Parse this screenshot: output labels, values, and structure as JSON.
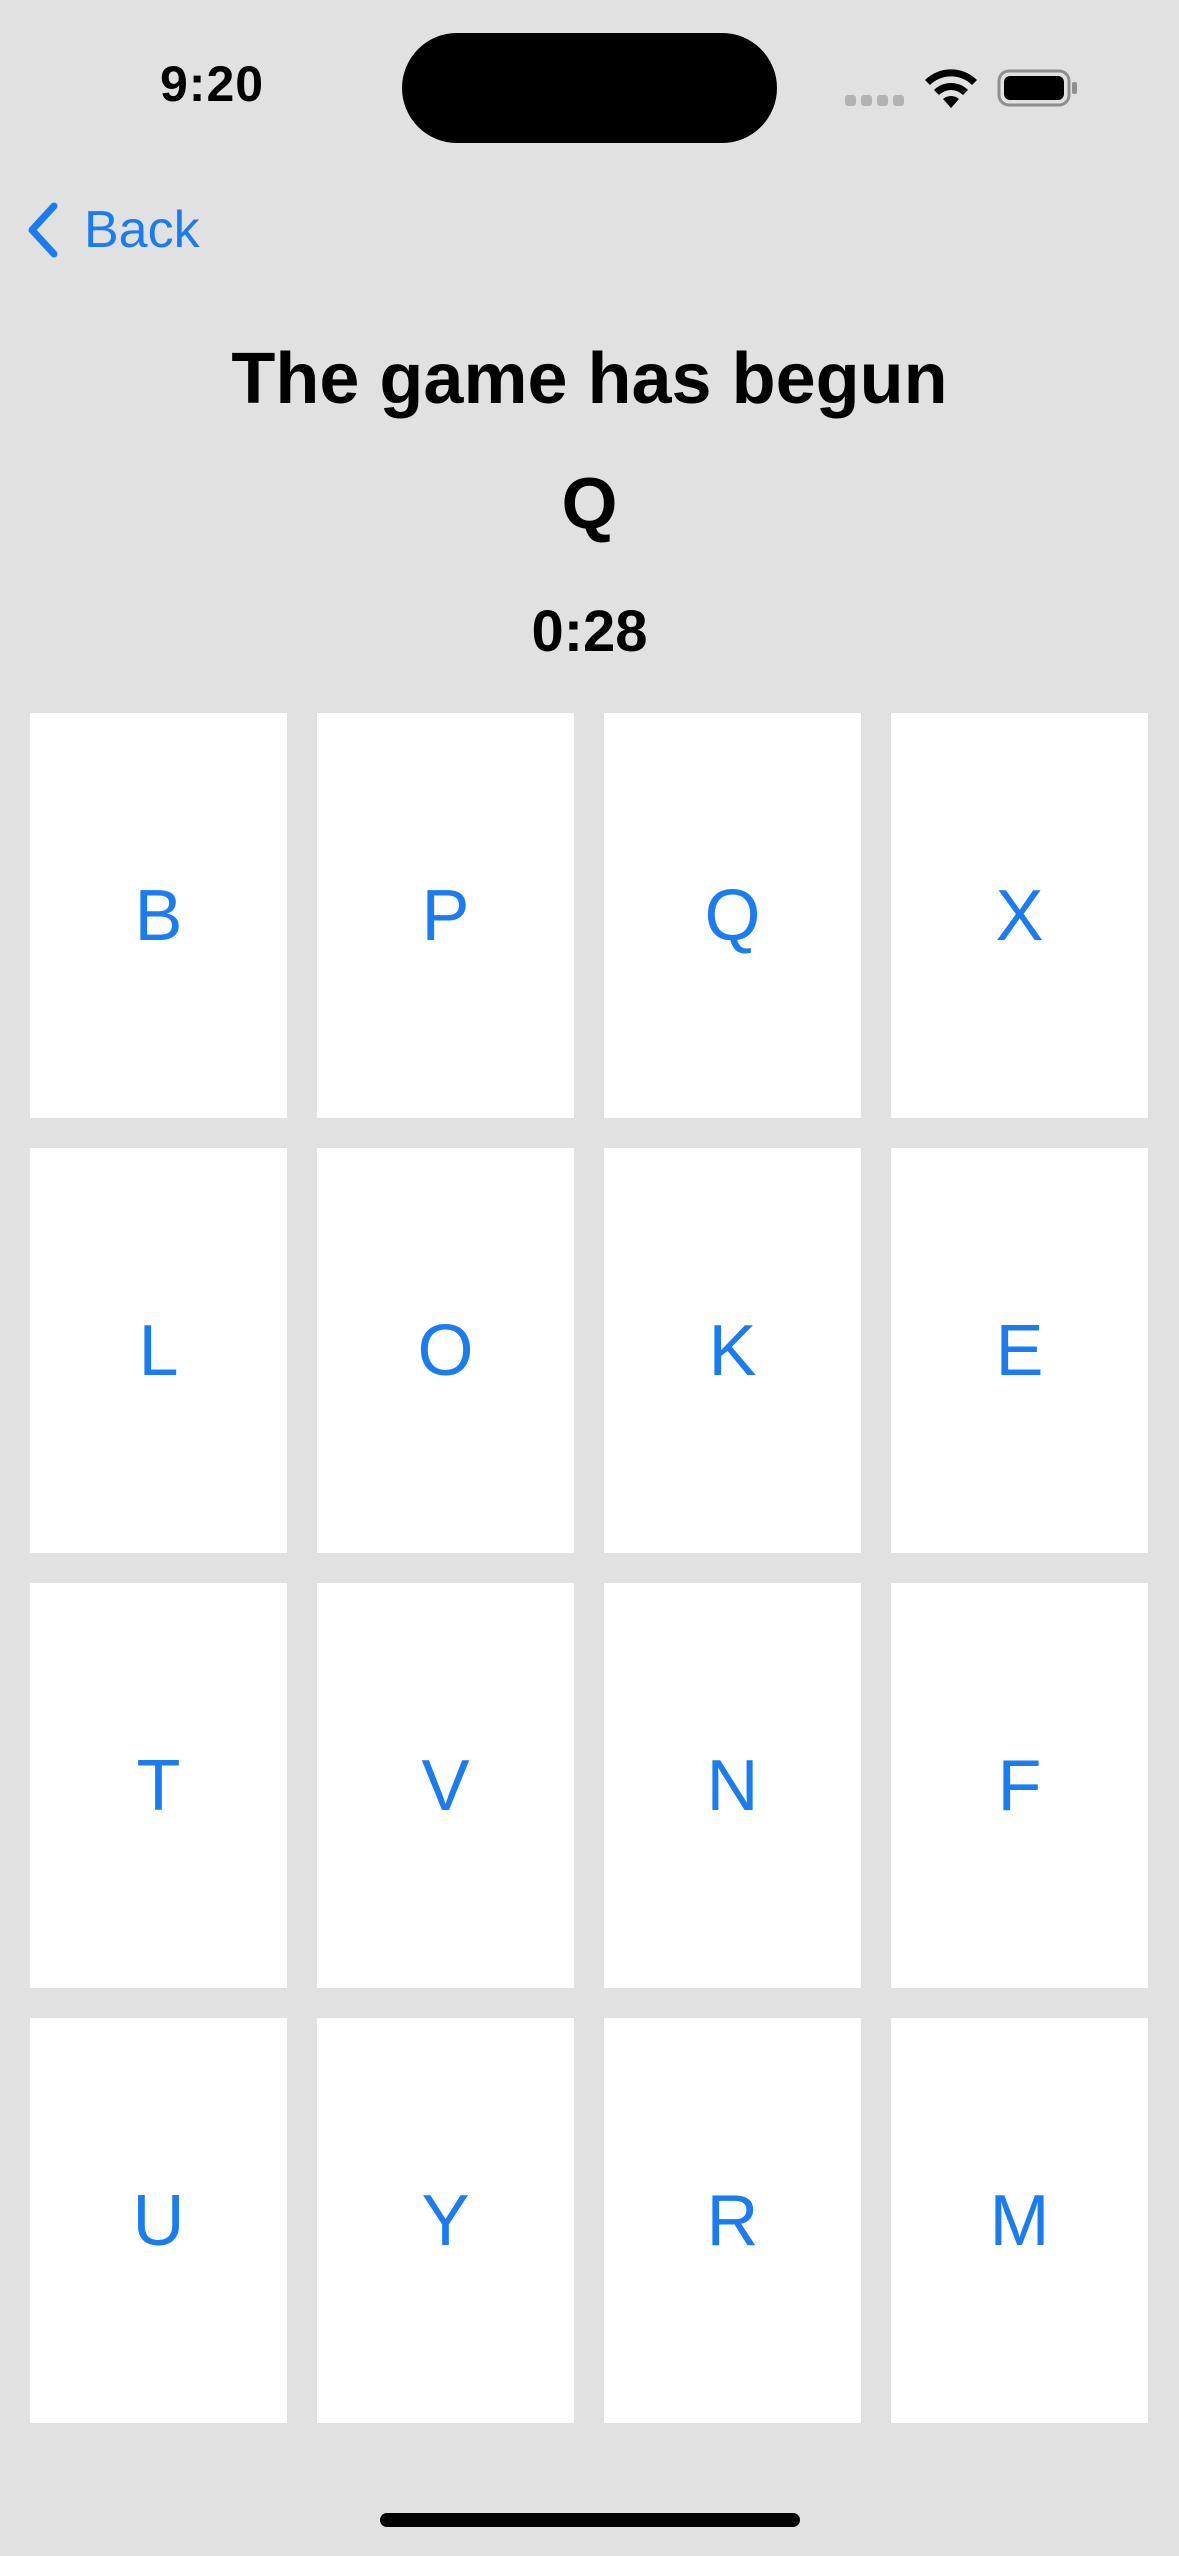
{
  "status_bar": {
    "time": "9:20",
    "icons": [
      "cellular-signal-icon",
      "wifi-icon",
      "battery-icon"
    ]
  },
  "nav": {
    "back_label": "Back",
    "back_icon": "chevron-left-icon"
  },
  "game": {
    "title": "The game has begun",
    "target_letter": "Q",
    "timer": "0:28"
  },
  "tiles": {
    "r0c0": "B",
    "r0c1": "P",
    "r0c2": "Q",
    "r0c3": "X",
    "r1c0": "L",
    "r1c1": "O",
    "r1c2": "K",
    "r1c3": "E",
    "r2c0": "T",
    "r2c1": "V",
    "r2c2": "N",
    "r2c3": "F",
    "r3c0": "U",
    "r3c1": "Y",
    "r3c2": "R",
    "r3c3": "M"
  },
  "colors": {
    "background": "#e1e1e1",
    "tile": "#ffffff",
    "accent": "#1a7cf0",
    "text": "#000000"
  }
}
